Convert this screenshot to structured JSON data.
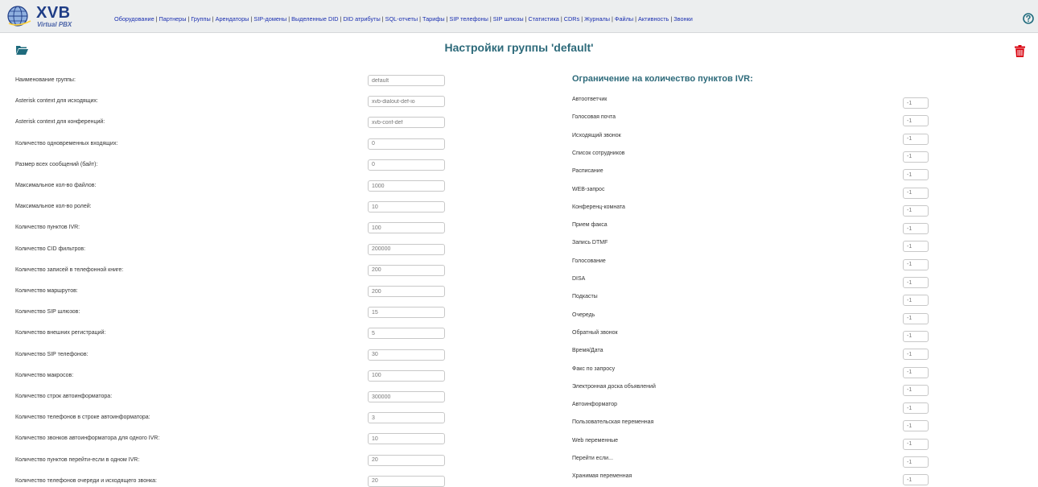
{
  "logo": {
    "text": "XVB",
    "sub": "Virtual PBX"
  },
  "nav": [
    "Оборудование",
    "Партнеры",
    "Группы",
    "Арендаторы",
    "SIP-домены",
    "Выделенные DID",
    "DID атрибуты",
    "SQL-отчеты",
    "Тарифы",
    "SIP телефоны",
    "SIP шлюзы",
    "Статистика",
    "CDRs",
    "Журналы",
    "Файлы",
    "Активность",
    "Звонки"
  ],
  "title": "Настройки группы 'default'",
  "left_fields": [
    {
      "label": "Наименование группы:",
      "value": "default"
    },
    {
      "label": "Asterisk context для исходящих:",
      "value": "xvb-dialout-def-io"
    },
    {
      "label": "Asterisk context для конференций:",
      "value": "xvb-conf-def"
    },
    {
      "label": "Количество одновременных входящих:",
      "value": "0"
    },
    {
      "label": "Размер всех сообщений (байт):",
      "value": "0"
    },
    {
      "label": "Максимальное кол-во файлов:",
      "value": "1000"
    },
    {
      "label": "Максимальное кол-во ролей:",
      "value": "10"
    },
    {
      "label": "Количество пунктов IVR:",
      "value": "100"
    },
    {
      "label": "Количество CID фильтров:",
      "value": "200000"
    },
    {
      "label": "Количество записей в телефонной книге:",
      "value": "200"
    },
    {
      "label": "Количество маршрутов:",
      "value": "200"
    },
    {
      "label": "Количество SIP шлюзов:",
      "value": "15"
    },
    {
      "label": "Количество внешних регистраций:",
      "value": "5"
    },
    {
      "label": "Количество SIP телефонов:",
      "value": "30"
    },
    {
      "label": "Количество макросов:",
      "value": "100"
    },
    {
      "label": "Количество строк автоинформатора:",
      "value": "300000"
    },
    {
      "label": "Количество телефонов в строке автоинформатора:",
      "value": "3"
    },
    {
      "label": "Количество звонков автоинформатора для одного IVR:",
      "value": "10"
    },
    {
      "label": "Количество пунктов перейти-если в одном IVR:",
      "value": "20"
    },
    {
      "label": "Количество телефонов очереди и исходящего звонка:",
      "value": "20"
    }
  ],
  "ivr_heading": "Ограничение на количество пунктов IVR:",
  "ivr_fields": [
    {
      "label": "Автоответчик",
      "value": "-1"
    },
    {
      "label": "Голосовая почта",
      "value": "-1"
    },
    {
      "label": "Исходящий звонок",
      "value": "-1"
    },
    {
      "label": "Список сотрудников",
      "value": "-1"
    },
    {
      "label": "Расписание",
      "value": "-1"
    },
    {
      "label": "WEB-запрос",
      "value": "-1"
    },
    {
      "label": "Конференц-комната",
      "value": "-1"
    },
    {
      "label": "Прием факса",
      "value": "-1"
    },
    {
      "label": "Запись DTMF",
      "value": "-1"
    },
    {
      "label": "Голосование",
      "value": "-1"
    },
    {
      "label": "DISA",
      "value": "-1"
    },
    {
      "label": "Подкасты",
      "value": "-1"
    },
    {
      "label": "Очередь",
      "value": "-1"
    },
    {
      "label": "Обратный звонок",
      "value": "-1"
    },
    {
      "label": "Время/Дата",
      "value": "-1"
    },
    {
      "label": "Факс по запросу",
      "value": "-1"
    },
    {
      "label": "Электронная доска объявлений",
      "value": "-1"
    },
    {
      "label": "Автоинформатор",
      "value": "-1"
    },
    {
      "label": "Пользовательская переменная",
      "value": "-1"
    },
    {
      "label": "Web переменные",
      "value": "-1"
    },
    {
      "label": "Перейти если...",
      "value": "-1"
    },
    {
      "label": "Хранимая переменная",
      "value": "-1"
    }
  ],
  "colors": {
    "topbar": "#eceeef",
    "nav_link": "#1a2fb0",
    "title": "#2d6a7a",
    "trash": "#d9000d",
    "folder": "#1f6b7d"
  },
  "icons": {
    "folder": "folder-open-icon",
    "trash": "trash-icon",
    "help": "help-circle-icon"
  }
}
